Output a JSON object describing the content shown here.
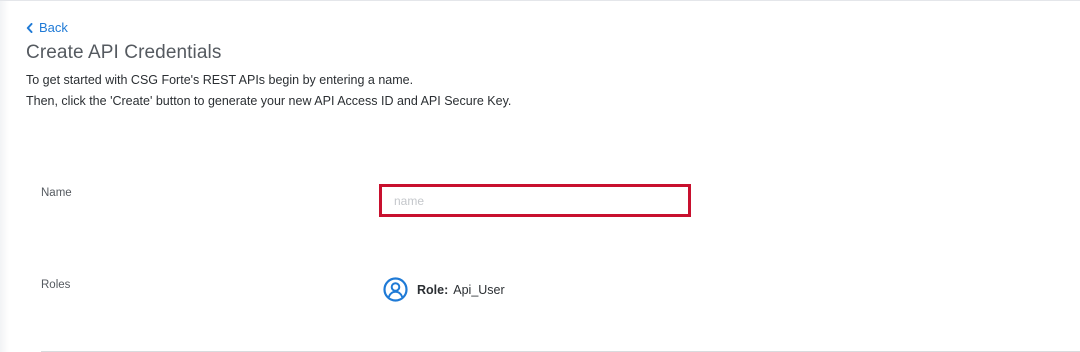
{
  "nav": {
    "back_label": "Back"
  },
  "header": {
    "title": "Create API Credentials",
    "intro_line_1": "To get started with CSG Forte's REST APIs begin by entering a name.",
    "intro_line_2": "Then, click the 'Create' button to generate your new API Access ID and API Secure Key."
  },
  "form": {
    "name_label": "Name",
    "name_value": "",
    "name_placeholder": "name",
    "roles_label": "Roles",
    "role_key": "Role:",
    "role_value": "Api_User",
    "role_icon": "user-circle-icon"
  },
  "colors": {
    "link": "#1f7ad6",
    "input_border_highlight": "#c8102e",
    "role_icon": "#1f7ad6"
  }
}
